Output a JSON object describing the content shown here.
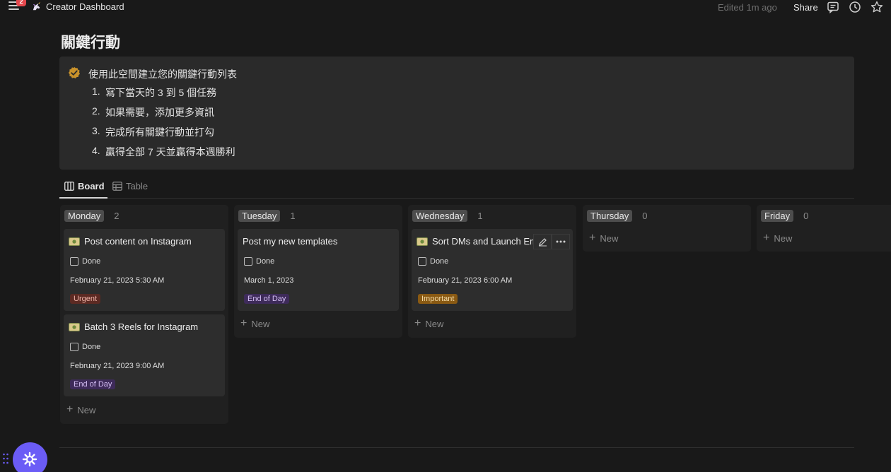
{
  "topbar": {
    "notification_count": "2",
    "breadcrumb": "Creator Dashboard",
    "edited": "Edited 1m ago",
    "share_label": "Share"
  },
  "page": {
    "title": "關鍵行動"
  },
  "callout": {
    "heading": "使用此空間建立您的關鍵行動列表",
    "steps": [
      {
        "num": "1.",
        "text": "寫下當天的 3 到 5 個任務"
      },
      {
        "num": "2.",
        "text": "如果需要，添加更多資訊"
      },
      {
        "num": "3.",
        "text": "完成所有關鍵行動並打勾"
      },
      {
        "num": "4.",
        "text": "贏得全部 7 天並贏得本週勝利"
      }
    ]
  },
  "views": {
    "board_label": "Board",
    "table_label": "Table"
  },
  "board": {
    "new_label": "New",
    "done_label": "Done",
    "columns": [
      {
        "name": "Monday",
        "count": "2",
        "cards": [
          {
            "title": "Post content on Instagram",
            "date": "February 21, 2023 5:30 AM",
            "tag": "Urgent"
          },
          {
            "title": "Batch 3 Reels for Instagram",
            "date": "February 21, 2023 9:00 AM",
            "tag": "End of Day"
          }
        ]
      },
      {
        "name": "Tuesday",
        "count": "1",
        "cards": [
          {
            "title": "Post my new templates",
            "date": "March 1, 2023",
            "tag": "End of Day"
          }
        ]
      },
      {
        "name": "Wednesday",
        "count": "1",
        "cards": [
          {
            "title": "Sort DMs and Launch Em",
            "date": "February 21, 2023 6:00 AM",
            "tag": "Important"
          }
        ]
      },
      {
        "name": "Thursday",
        "count": "0",
        "cards": []
      },
      {
        "name": "Friday",
        "count": "0",
        "cards": []
      }
    ]
  },
  "colors": {
    "background": "#191919",
    "fab": "#6b5cf6",
    "badge": "#e5484d",
    "callout_icon": "#c9922b"
  }
}
